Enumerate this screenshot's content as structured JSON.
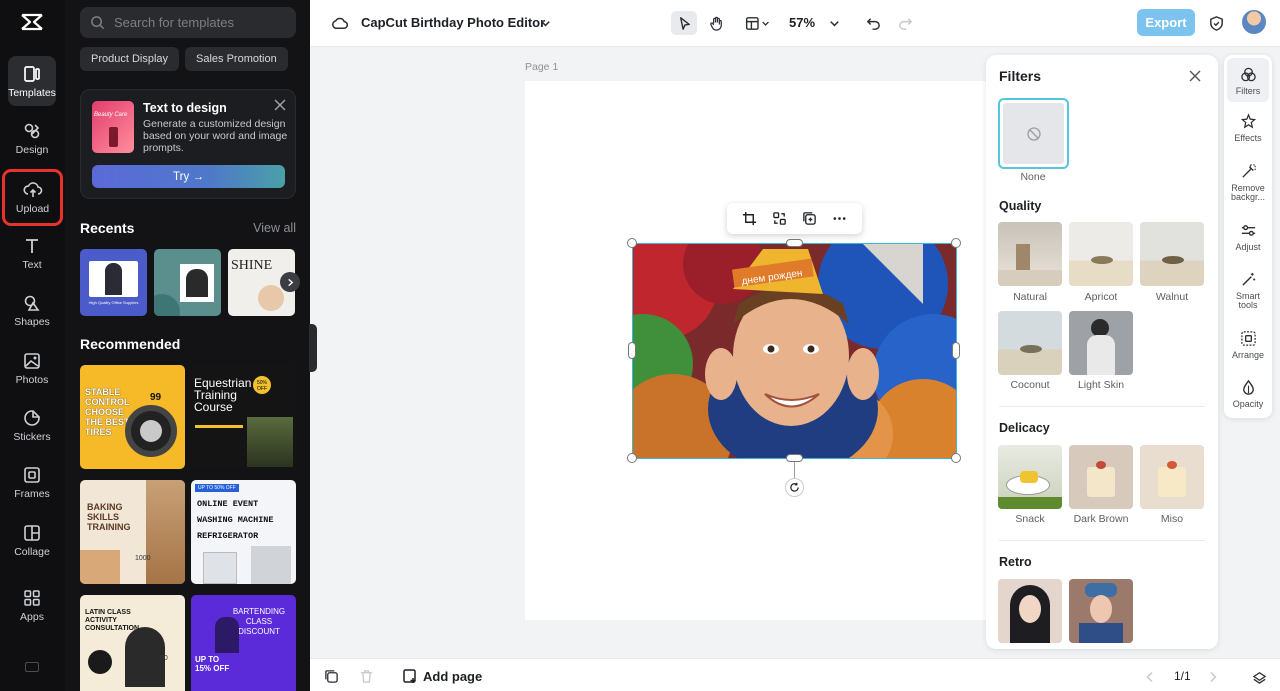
{
  "rail": {
    "items": [
      {
        "label": "Templates",
        "icon": "templates-icon"
      },
      {
        "label": "Design",
        "icon": "design-icon"
      },
      {
        "label": "Upload",
        "icon": "upload-icon"
      },
      {
        "label": "Text",
        "icon": "text-icon"
      },
      {
        "label": "Shapes",
        "icon": "shapes-icon"
      },
      {
        "label": "Photos",
        "icon": "photos-icon"
      },
      {
        "label": "Stickers",
        "icon": "stickers-icon"
      },
      {
        "label": "Frames",
        "icon": "frames-icon"
      },
      {
        "label": "Collage",
        "icon": "collage-icon"
      },
      {
        "label": "Apps",
        "icon": "apps-icon"
      }
    ]
  },
  "panel": {
    "search_placeholder": "Search for templates",
    "chips": [
      "Product Display",
      "Sales Promotion"
    ],
    "text_to_design": {
      "title": "Text to design",
      "description": "Generate a customized design based on your word and image prompts.",
      "button": "Try",
      "thumb_text": "Beauty Care"
    },
    "recents_title": "Recents",
    "view_all": "View all",
    "recents": [
      {
        "caption": "High Quality Office Supplies"
      },
      {
        "caption": ""
      },
      {
        "caption": "SHINE"
      }
    ],
    "recommended_title": "Recommended",
    "recommended": [
      {
        "text": "STABLE CONTROL CHOOSE THE BEST TIRES",
        "badge": "99"
      },
      {
        "text": "Equestrian Training Course",
        "badge": "50% OFF"
      },
      {
        "text": "BAKING SKILLS TRAINING",
        "badge": "1000"
      },
      {
        "text": "ONLINE EVENT WASHING MACHINE REFRIGERATOR",
        "badge": "UP TO 50% OFF"
      },
      {
        "text": "LATIN CLASS ACTIVITY CONSULTATION",
        "badge": "50"
      },
      {
        "text": "BARTENDING CLASS DISCOUNT",
        "badge": "UP TO 15% OFF"
      }
    ]
  },
  "topbar": {
    "title": "CapCut Birthday Photo Editor",
    "zoom": "57%",
    "export": "Export"
  },
  "canvas": {
    "page_label": "Page 1",
    "photo_banner_text": "днем рожден"
  },
  "filters": {
    "title": "Filters",
    "none_label": "None",
    "sections": [
      {
        "title": "Quality",
        "items": [
          "Natural",
          "Apricot",
          "Walnut",
          "Coconut",
          "Light Skin"
        ]
      },
      {
        "title": "Delicacy",
        "items": [
          "Snack",
          "Dark Brown",
          "Miso"
        ]
      },
      {
        "title": "Retro",
        "items": [
          "",
          ""
        ]
      }
    ]
  },
  "tools": {
    "items": [
      "Filters",
      "Effects",
      "Remove backgr...",
      "Adjust",
      "Smart tools",
      "Arrange",
      "Opacity"
    ]
  },
  "bottom": {
    "add_page": "Add page",
    "page_indicator": "1/1"
  },
  "colors": {
    "accent": "#3bb6d9",
    "export": "#7cc3ef",
    "highlight": "#e8322c"
  }
}
